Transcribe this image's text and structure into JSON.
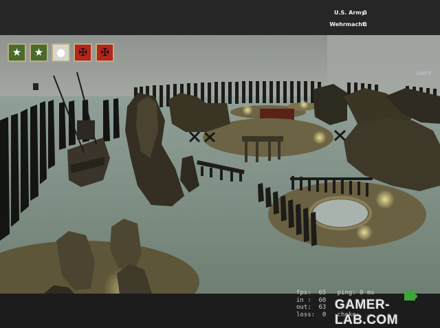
{
  "hud": {
    "scores": [
      {
        "team": "U.S. Army:",
        "value": "0"
      },
      {
        "team": "Wehrmacht:",
        "value": "0"
      }
    ],
    "flags": [
      {
        "owner": "allies",
        "icon": "us-star-flag-icon",
        "glyph": "★"
      },
      {
        "owner": "allies",
        "icon": "us-star-flag-icon",
        "glyph": "★"
      },
      {
        "owner": "neutral",
        "icon": "neutral-flag-icon",
        "glyph": "●"
      },
      {
        "owner": "axis",
        "icon": "german-cross-flag-icon",
        "glyph": "✠"
      },
      {
        "owner": "axis",
        "icon": "german-cross-flag-icon",
        "glyph": "✠"
      }
    ],
    "net_graph": [
      {
        "left": "fps:  65",
        "right": "ping: 0 ms"
      },
      {
        "left": "in :  60",
        "right": ""
      },
      {
        "left": "out:  63",
        "right": ""
      },
      {
        "left": "loss:  0",
        "right": "choke:"
      }
    ],
    "watermark": "GAMER-LAB.COM",
    "world_text": "UNITY"
  },
  "colors": {
    "sky": "#9a9d98",
    "water": "#7d8a80",
    "sand": "#6f6545",
    "rock": "#2f2a1f",
    "us_green": "#4b6a2e",
    "de_red": "#b3251e"
  }
}
